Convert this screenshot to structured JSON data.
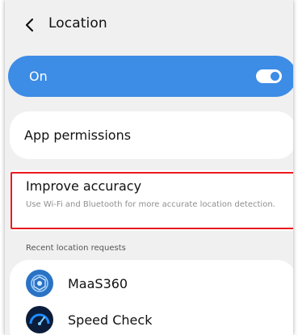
{
  "header": {
    "back_icon": "chevron-left-icon",
    "title": "Location"
  },
  "location_toggle": {
    "label": "On",
    "state": true,
    "accent_color": "#3d8ce6"
  },
  "settings": {
    "app_permissions_label": "App permissions",
    "improve_accuracy": {
      "title": "Improve accuracy",
      "description": "Use Wi-Fi and Bluetooth for more accurate location detection."
    }
  },
  "recent_requests": {
    "section_label": "Recent location requests",
    "apps": [
      {
        "name": "MaaS360",
        "icon": "maas360-app-icon"
      },
      {
        "name": "Speed Check",
        "icon": "speed-check-app-icon"
      }
    ]
  },
  "highlight_color": "#e8191f"
}
